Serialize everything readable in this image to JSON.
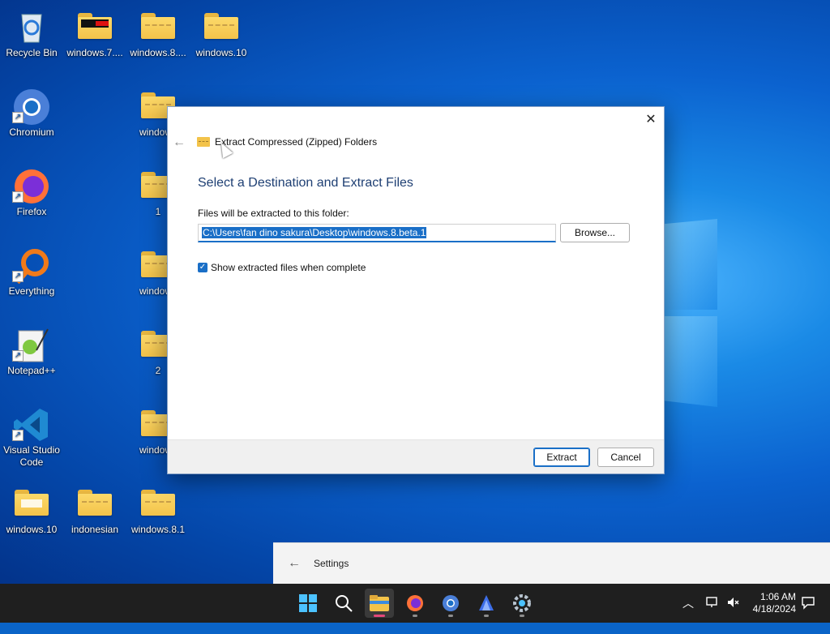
{
  "desktop": {
    "icons": [
      {
        "label": "Recycle Bin",
        "icon": "recycle-bin-icon",
        "kind": "recycle"
      },
      {
        "label": "windows.7....",
        "icon": "folder-icon",
        "kind": "folder-dark"
      },
      {
        "label": "windows.8....",
        "icon": "zip-folder-icon",
        "kind": "zip"
      },
      {
        "label": "windows.10",
        "icon": "zip-folder-icon",
        "kind": "zip"
      },
      {
        "label": "Chromium",
        "icon": "chromium-icon",
        "kind": "chromium"
      },
      {
        "label": "windows",
        "icon": "zip-folder-icon",
        "kind": "zip"
      },
      {
        "label": "Firefox",
        "icon": "firefox-icon",
        "kind": "firefox"
      },
      {
        "label": "1",
        "icon": "zip-folder-icon",
        "kind": "zip"
      },
      {
        "label": "Everything",
        "icon": "everything-icon",
        "kind": "everything"
      },
      {
        "label": "windows",
        "icon": "zip-folder-icon",
        "kind": "zip"
      },
      {
        "label": "Notepad++",
        "icon": "notepadpp-icon",
        "kind": "notepad"
      },
      {
        "label": "2",
        "icon": "zip-folder-icon",
        "kind": "zip"
      },
      {
        "label": "Visual Studio Code",
        "icon": "vscode-icon",
        "kind": "vscode"
      },
      {
        "label": "windows",
        "icon": "zip-folder-icon",
        "kind": "zip"
      },
      {
        "label": "windows.10",
        "icon": "folder-icon",
        "kind": "folder"
      },
      {
        "label": "indonesian",
        "icon": "zip-folder-icon",
        "kind": "zip"
      },
      {
        "label": "windows.8.1",
        "icon": "zip-folder-icon",
        "kind": "zip"
      }
    ]
  },
  "dialog": {
    "window_title": "Extract Compressed (Zipped) Folders",
    "heading": "Select a Destination and Extract Files",
    "destination_label": "Files will be extracted to this folder:",
    "destination_path": "C:\\Users\\fan dino sakura\\Desktop\\windows.8.beta.1",
    "browse_label": "Browse...",
    "show_files_label": "Show extracted files when complete",
    "show_files_checked": true,
    "extract_label": "Extract",
    "cancel_label": "Cancel"
  },
  "settings_window": {
    "title": "Settings"
  },
  "taskbar": {
    "apps": [
      "windows-start-icon",
      "search-icon",
      "file-explorer-icon",
      "firefox-icon",
      "chromium-icon",
      "app-icon",
      "settings-gear-icon"
    ],
    "time": "1:06 AM",
    "date": "4/18/2024"
  },
  "colors": {
    "accent": "#1a6fc7",
    "heading": "#1e3f73",
    "taskbar": "#1f1f1f"
  }
}
